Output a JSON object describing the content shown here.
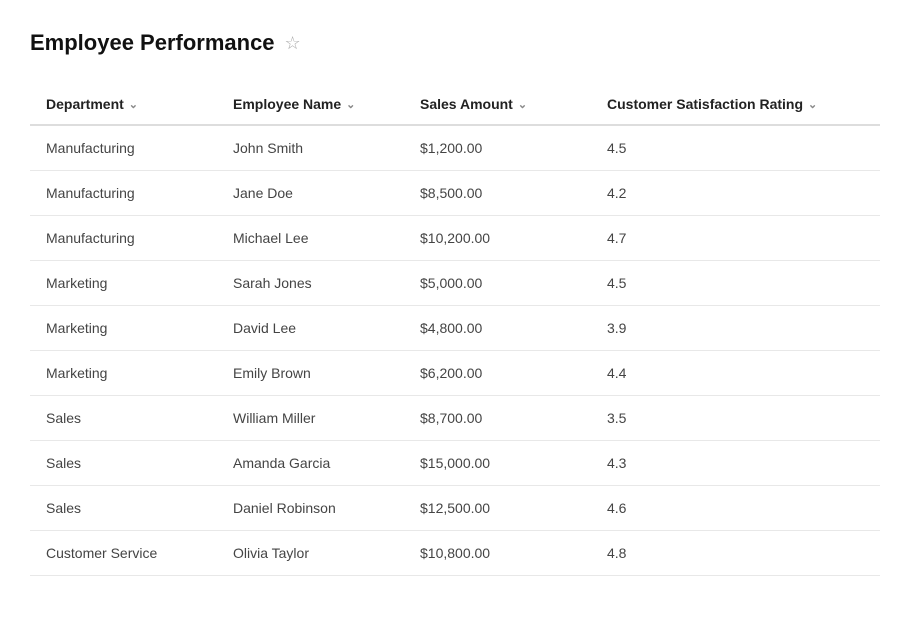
{
  "header": {
    "title": "Employee Performance",
    "star_label": "☆"
  },
  "table": {
    "columns": [
      {
        "key": "department",
        "label": "Department"
      },
      {
        "key": "employee",
        "label": "Employee Name"
      },
      {
        "key": "sales",
        "label": "Sales Amount"
      },
      {
        "key": "rating",
        "label": "Customer Satisfaction Rating"
      }
    ],
    "rows": [
      {
        "department": "Manufacturing",
        "employee": "John Smith",
        "sales": "$1,200.00",
        "rating": "4.5"
      },
      {
        "department": "Manufacturing",
        "employee": "Jane Doe",
        "sales": "$8,500.00",
        "rating": "4.2"
      },
      {
        "department": "Manufacturing",
        "employee": "Michael Lee",
        "sales": "$10,200.00",
        "rating": "4.7"
      },
      {
        "department": "Marketing",
        "employee": "Sarah Jones",
        "sales": "$5,000.00",
        "rating": "4.5"
      },
      {
        "department": "Marketing",
        "employee": "David Lee",
        "sales": "$4,800.00",
        "rating": "3.9"
      },
      {
        "department": "Marketing",
        "employee": "Emily Brown",
        "sales": "$6,200.00",
        "rating": "4.4"
      },
      {
        "department": "Sales",
        "employee": "William Miller",
        "sales": "$8,700.00",
        "rating": "3.5"
      },
      {
        "department": "Sales",
        "employee": "Amanda Garcia",
        "sales": "$15,000.00",
        "rating": "4.3"
      },
      {
        "department": "Sales",
        "employee": "Daniel Robinson",
        "sales": "$12,500.00",
        "rating": "4.6"
      },
      {
        "department": "Customer Service",
        "employee": "Olivia Taylor",
        "sales": "$10,800.00",
        "rating": "4.8"
      }
    ]
  }
}
